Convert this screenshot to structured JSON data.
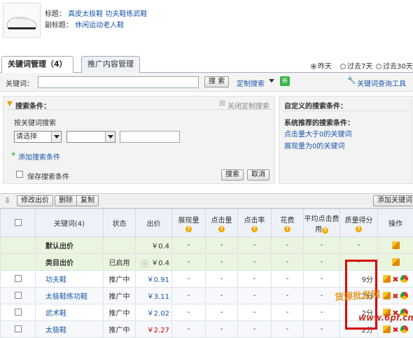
{
  "product": {
    "title_label": "标题：",
    "title_value": "真皮太极鞋  功夫鞋练武鞋",
    "subtitle_label": "副标题：",
    "subtitle_value": "休闲运动老人鞋"
  },
  "tabs": [
    {
      "label": "关键词管理（4）"
    },
    {
      "label": "推广内容管理"
    }
  ],
  "date_range": {
    "options": [
      "昨天",
      "过去7天",
      "过去30天"
    ],
    "selected": "昨天"
  },
  "keyword_search": {
    "label": "关键词：",
    "value": "",
    "search_button": "搜 索",
    "custom_search": "定制搜索",
    "new_badge": "新",
    "tool_link": "关键词查询工具"
  },
  "search_conditions": {
    "title": "搜索条件：",
    "close_link": "关闭定制搜索",
    "by_keyword_label": "按关键词搜索",
    "select1_value": "请选择",
    "select2_value": "",
    "text_value": "",
    "add_condition": "添加搜索条件",
    "save_label": "保存搜索条件",
    "search_btn": "搜索",
    "cancel_btn": "取消"
  },
  "custom_conditions": {
    "title": "自定义的搜索条件：",
    "recommended_title": "系统推荐的搜索条件：",
    "links": [
      "点击量大于0的关键词",
      "展现量为0的关键词"
    ]
  },
  "toolbar": {
    "modify_price": "修改出价",
    "delete": "删除",
    "copy": "复制",
    "add_keyword": "添加关键词"
  },
  "table": {
    "headers": [
      "关键词(4)",
      "状态",
      "出价",
      "展现量",
      "点击量",
      "点击率",
      "花费",
      "平均点击费用",
      "质量得分",
      "操作"
    ],
    "help_mark": "?",
    "special_rows": [
      {
        "name": "默认出价",
        "status": "",
        "price": "￥0.4",
        "cells": [
          "-",
          "-",
          "-",
          "-",
          "-",
          "-"
        ]
      },
      {
        "name": "类目出价",
        "status": "已启用",
        "price": "￥0.4",
        "cells": [
          "-",
          "-",
          "-",
          "-",
          "-",
          "-"
        ]
      }
    ],
    "rows": [
      {
        "keyword": "功夫鞋",
        "status": "推广中",
        "price": "￥0.91",
        "cells": [
          "-",
          "-",
          "-",
          "-",
          "-"
        ],
        "score": "9分"
      },
      {
        "keyword": "太极鞋练功鞋",
        "status": "推广中",
        "price": "￥3.11",
        "cells": [
          "-",
          "-",
          "-",
          "-",
          "-"
        ],
        "score": "2分"
      },
      {
        "keyword": "武术鞋",
        "status": "推广中",
        "price": "￥2.02",
        "cells": [
          "-",
          "-",
          "-",
          "-",
          "-"
        ],
        "score": "2分"
      },
      {
        "keyword": "太极鞋",
        "status": "推广中",
        "price": "￥2.27",
        "cells": [
          "-",
          "-",
          "-",
          "-",
          "-"
        ],
        "score": "2分"
      }
    ]
  },
  "watermark": {
    "line1": "货源批发网",
    "line2": "www.6pf.cn"
  },
  "colors": {
    "link": "#1a56a8",
    "highlight": "#d60000",
    "green_row": "#eaf5df",
    "price_red": "#d40000"
  }
}
